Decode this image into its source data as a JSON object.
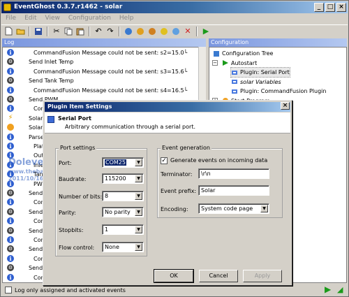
{
  "window": {
    "title": "EventGhost 0.3.7.r1462 - solar"
  },
  "menu": [
    "File",
    "Edit",
    "View",
    "Configuration",
    "Help"
  ],
  "panes": {
    "log_title": "Log",
    "config_title": "Configuration"
  },
  "log": [
    {
      "icon": "info",
      "indent": 1,
      "text": "CommandFusion Message could not be sent: s2=15.0└"
    },
    {
      "icon": "action",
      "indent": 0,
      "text": "Send Inlet Temp"
    },
    {
      "icon": "info",
      "indent": 1,
      "text": "CommandFusion Message could not be sent: s3=15.6└"
    },
    {
      "icon": "action",
      "indent": 0,
      "text": "Send Tank Temp"
    },
    {
      "icon": "info",
      "indent": 1,
      "text": "CommandFusion Message could not be sent: s4=16.5└"
    },
    {
      "icon": "action",
      "indent": 0,
      "text": "Send PWM"
    },
    {
      "icon": "info",
      "indent": 1,
      "text": "Con"
    },
    {
      "icon": "event",
      "indent": 0,
      "text": "Solar. , 2"
    },
    {
      "icon": "sun",
      "indent": 0,
      "text": "Solar Pa"
    },
    {
      "icon": "info",
      "indent": 0,
      "text": "Parse"
    },
    {
      "icon": "info",
      "indent": 1,
      "text": "Plat"
    },
    {
      "icon": "info",
      "indent": 1,
      "text": "Outer"
    },
    {
      "icon": "info",
      "indent": 1,
      "text": "Inle"
    },
    {
      "icon": "info",
      "indent": 1,
      "text": "Tan"
    },
    {
      "icon": "info",
      "indent": 1,
      "text": "PWI"
    },
    {
      "icon": "action",
      "indent": 0,
      "text": "Send"
    },
    {
      "icon": "info",
      "indent": 1,
      "text": "Con"
    },
    {
      "icon": "action",
      "indent": 0,
      "text": "Send"
    },
    {
      "icon": "info",
      "indent": 1,
      "text": "Con"
    },
    {
      "icon": "action",
      "indent": 0,
      "text": "Send"
    },
    {
      "icon": "info",
      "indent": 1,
      "text": "Con"
    },
    {
      "icon": "action",
      "indent": 0,
      "text": "Send"
    },
    {
      "icon": "info",
      "indent": 1,
      "text": "Con"
    },
    {
      "icon": "action",
      "indent": 0,
      "text": "Send"
    },
    {
      "icon": "info",
      "indent": 1,
      "text": "Con"
    }
  ],
  "tree": [
    {
      "text": "Configuration Tree",
      "level": 0,
      "icon": "tree"
    },
    {
      "text": "Autostart",
      "level": 1,
      "icon": "play"
    },
    {
      "text": "Plugin: Serial Port",
      "level": 2,
      "icon": "plugin",
      "selected": true
    },
    {
      "text": "solar Variables",
      "level": 2,
      "icon": "plugin",
      "italic": true
    },
    {
      "text": "Plugin: CommandFusion Plugin",
      "level": 2,
      "icon": "plugin"
    },
    {
      "text": "Start Program",
      "level": 1,
      "icon": "sun"
    }
  ],
  "watermark": {
    "line1": "Dolevey",
    "line2": "www.thebackshed.com",
    "line3": "2011/10/16"
  },
  "status": {
    "checkbox_label": "Log only assigned and activated events"
  },
  "dialog": {
    "title": "Plugin Item Settings",
    "plugin_name": "Serial Port",
    "plugin_desc": "Arbitrary communication through a serial port.",
    "port_settings": {
      "label": "Port settings",
      "port_label": "Port:",
      "port_value": "COM25",
      "baud_label": "Baudrate:",
      "baud_value": "115200",
      "bits_label": "Number of bits:",
      "bits_value": "8",
      "parity_label": "Parity:",
      "parity_value": "No parity",
      "stop_label": "Stopbits:",
      "stop_value": "1",
      "flow_label": "Flow control:",
      "flow_value": "None"
    },
    "event_generation": {
      "label": "Event generation",
      "generate_label": "Generate events on incoming data",
      "terminator_label": "Terminator:",
      "terminator_value": "\\r\\n",
      "prefix_label": "Event prefix:",
      "prefix_value": "Solar",
      "encoding_label": "Encoding:",
      "encoding_value": "System code page"
    },
    "buttons": {
      "ok": "OK",
      "cancel": "Cancel",
      "apply": "Apply"
    }
  }
}
